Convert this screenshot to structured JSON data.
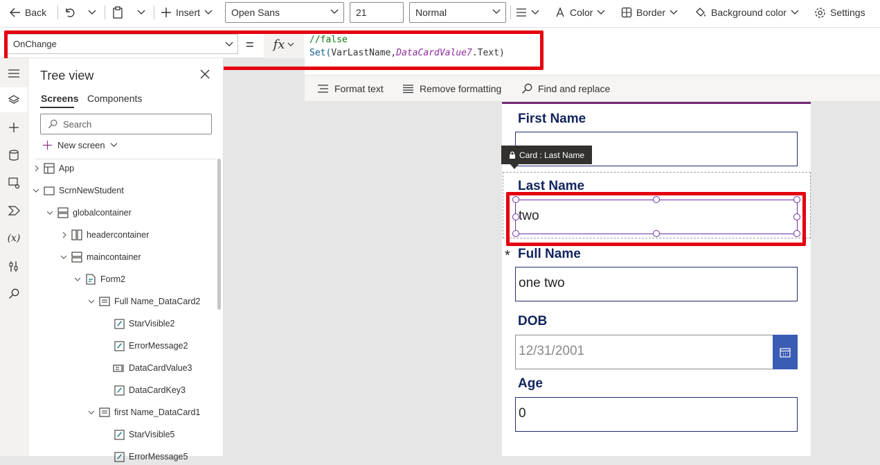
{
  "toolbar": {
    "back_label": "Back",
    "insert_label": "Insert",
    "font_family": "Open Sans",
    "font_size": "21",
    "font_weight": "Normal",
    "color_label": "Color",
    "border_label": "Border",
    "background_color_label": "Background color",
    "settings_label": "Settings"
  },
  "formula_bar": {
    "property": "OnChange",
    "equals": "=",
    "fx": "fx",
    "code_line1": "//false",
    "code_func": "Set(",
    "code_var": "VarLastName,",
    "code_ctrl": "DataCardValue7",
    "code_tail": ".Text)"
  },
  "format_bar": {
    "format_text": "Format text",
    "remove_formatting": "Remove formatting",
    "find_replace": "Find and replace"
  },
  "tree_view": {
    "title": "Tree view",
    "tab_screens": "Screens",
    "tab_components": "Components",
    "search_placeholder": "Search",
    "new_screen": "New screen",
    "items": [
      {
        "label": "App"
      },
      {
        "label": "ScrnNewStudent"
      },
      {
        "label": "globalcontainer"
      },
      {
        "label": "headercontainer"
      },
      {
        "label": "maincontainer"
      },
      {
        "label": "Form2"
      },
      {
        "label": "Full Name_DataCard2"
      },
      {
        "label": "StarVisible2"
      },
      {
        "label": "ErrorMessage2"
      },
      {
        "label": "DataCardValue3"
      },
      {
        "label": "DataCardKey3"
      },
      {
        "label": "first Name_DataCard1"
      },
      {
        "label": "StarVisible5"
      },
      {
        "label": "ErrorMessage5"
      }
    ]
  },
  "form": {
    "first_name_label": "First Name",
    "first_name_value": "",
    "tooltip": "Card : Last Name",
    "last_name_label": "Last Name",
    "last_name_value": "two",
    "full_name_required": "*",
    "full_name_label": "Full Name",
    "full_name_value": "one two",
    "dob_label": "DOB",
    "dob_value": "12/31/2001",
    "age_label": "Age",
    "age_value": "0"
  },
  "colors": {
    "highlight": "#e4000f",
    "label_navy": "#12245e",
    "calendar_button": "#3b5cb4",
    "selection_purple": "#742774"
  }
}
